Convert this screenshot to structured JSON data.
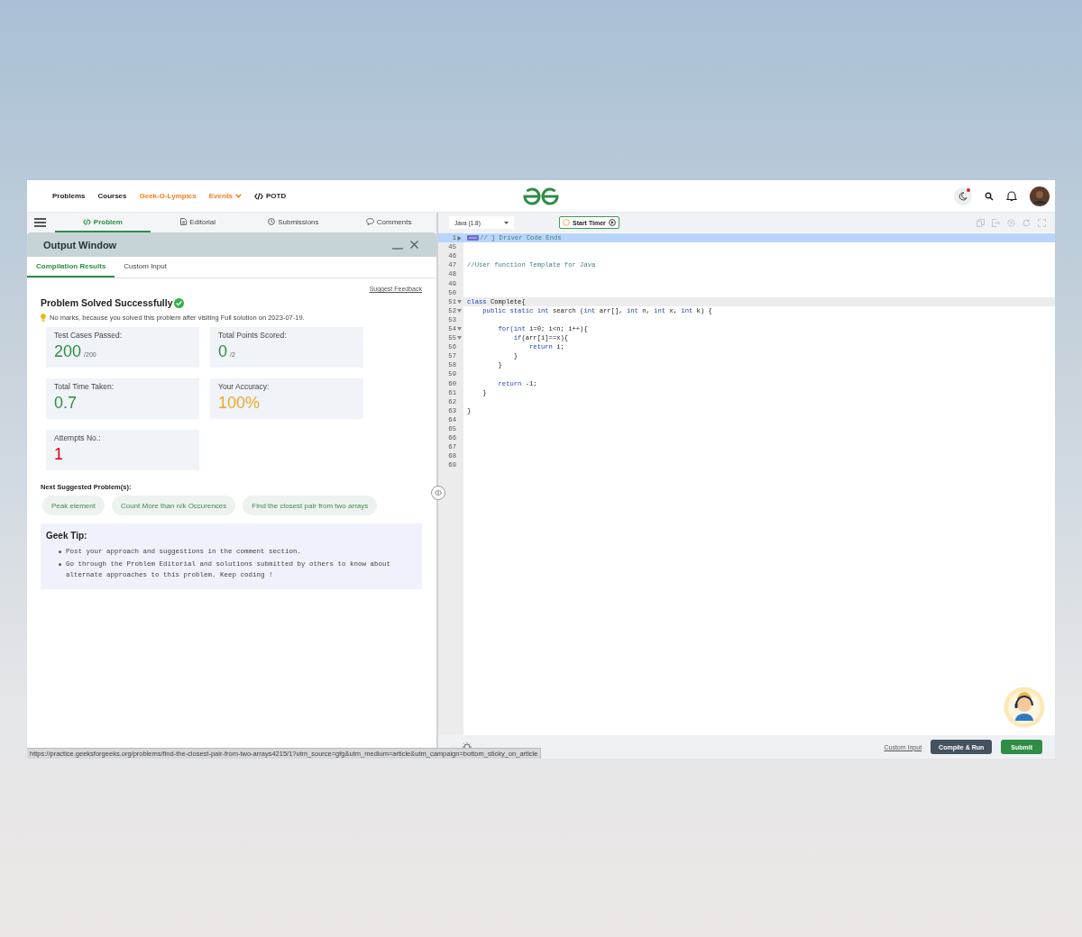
{
  "nav": {
    "items": [
      {
        "label": "Problems",
        "color": "#1e1e1e",
        "caret": false,
        "code_icon": false
      },
      {
        "label": "Courses",
        "color": "#1e1e1e",
        "caret": false,
        "code_icon": false
      },
      {
        "label": "Geek-O-Lympics",
        "color": "#f07f19",
        "caret": false,
        "code_icon": false
      },
      {
        "label": "Events",
        "color": "#f07f19",
        "caret": true,
        "code_icon": false
      },
      {
        "label": "POTD",
        "color": "#1e1e1e",
        "caret": false,
        "code_icon": true
      }
    ]
  },
  "panel_tabs": [
    {
      "label": "Problem",
      "selected": true
    },
    {
      "label": "Editorial",
      "selected": false
    },
    {
      "label": "Submissions",
      "selected": false
    },
    {
      "label": "Comments",
      "selected": false
    }
  ],
  "output_window": {
    "title": "Output Window",
    "tabs": [
      {
        "label": "Compilation Results",
        "selected": true
      },
      {
        "label": "Custom Input",
        "selected": false
      }
    ],
    "feedback_link": "Suggest Feedback",
    "status": "Problem Solved Successfully",
    "note": "No marks, because you solved this problem after visiting Full solution on 2023-07-19.",
    "stats": [
      {
        "label": "Test Cases Passed:",
        "value": "200",
        "total": "/200",
        "color": "#2f8d46"
      },
      {
        "label": "Total Points Scored:",
        "value": "0",
        "total": "/2",
        "color": "#2f8d46"
      },
      {
        "label": "Total Time Taken:",
        "value": "0.7",
        "color": "#2f8d46"
      },
      {
        "label": "Your Accuracy:",
        "value": "100%",
        "color": "#e9a92b"
      },
      {
        "label": "Attempts No.:",
        "value": "1",
        "color": "#d5000f"
      }
    ],
    "suggested_heading": "Next Suggested Problem(s):",
    "suggested": [
      "Peak element",
      "Count More than n/k Occurences",
      "Find the closest pair from two arrays"
    ],
    "tip": {
      "title": "Geek Tip:",
      "items": [
        "Post your approach and suggestions in the comment section.",
        "Go through the Problem Editorial and solutions submitted by others to know about alternate approaches to this problem. Keep coding !"
      ]
    }
  },
  "editor": {
    "language": "Java (1.8)",
    "timer_button": "Start Timer",
    "lines": [
      {
        "num": "1",
        "foldable": true,
        "collapsed": true,
        "selected": true,
        "current": false,
        "tokens": [
          {
            "text": "// } Driver Code Ends",
            "kind": "comment"
          }
        ]
      },
      {
        "num": "45",
        "foldable": false,
        "selected": false,
        "current": false
      },
      {
        "num": "46",
        "foldable": false,
        "selected": false,
        "current": false
      },
      {
        "num": "47",
        "foldable": false,
        "selected": false,
        "current": false,
        "tokens": [
          {
            "text": "//User function Template for Java",
            "kind": "comment"
          }
        ]
      },
      {
        "num": "48",
        "foldable": false,
        "selected": false,
        "current": false
      },
      {
        "num": "49",
        "foldable": false,
        "selected": false,
        "current": false
      },
      {
        "num": "50",
        "foldable": false,
        "selected": false,
        "current": false
      },
      {
        "num": "51",
        "foldable": true,
        "collapsed": false,
        "selected": false,
        "current": true,
        "tokens": [
          {
            "text": "class",
            "kind": "keyword"
          },
          {
            "text": " Complete{",
            "kind": "plain"
          }
        ]
      },
      {
        "num": "52",
        "foldable": true,
        "collapsed": false,
        "selected": false,
        "current": false,
        "tokens": [
          {
            "text": "    public static int",
            "kind": "keyword"
          },
          {
            "text": " search (",
            "kind": "plain"
          },
          {
            "text": "int",
            "kind": "keyword"
          },
          {
            "text": " arr[], ",
            "kind": "plain"
          },
          {
            "text": "int",
            "kind": "keyword"
          },
          {
            "text": " n, ",
            "kind": "plain"
          },
          {
            "text": "int",
            "kind": "keyword"
          },
          {
            "text": " x, ",
            "kind": "plain"
          },
          {
            "text": "int",
            "kind": "keyword"
          },
          {
            "text": " k) {",
            "kind": "plain"
          }
        ]
      },
      {
        "num": "53",
        "foldable": false,
        "selected": false,
        "current": false
      },
      {
        "num": "54",
        "foldable": true,
        "collapsed": false,
        "selected": false,
        "current": false,
        "tokens": [
          {
            "text": "        for(int",
            "kind": "keyword"
          },
          {
            "text": " i=0; i<n; i++){",
            "kind": "plain"
          }
        ]
      },
      {
        "num": "55",
        "foldable": true,
        "collapsed": false,
        "selected": false,
        "current": false,
        "tokens": [
          {
            "text": "            if",
            "kind": "keyword"
          },
          {
            "text": "(arr[i]==x){",
            "kind": "plain"
          }
        ]
      },
      {
        "num": "56",
        "foldable": false,
        "selected": false,
        "current": false,
        "tokens": [
          {
            "text": "                return",
            "kind": "keyword"
          },
          {
            "text": " i;",
            "kind": "plain"
          }
        ]
      },
      {
        "num": "57",
        "foldable": false,
        "selected": false,
        "current": false,
        "tokens": [
          {
            "text": "            }",
            "kind": "plain"
          }
        ]
      },
      {
        "num": "58",
        "foldable": false,
        "selected": false,
        "current": false,
        "tokens": [
          {
            "text": "        }",
            "kind": "plain"
          }
        ]
      },
      {
        "num": "59",
        "foldable": false,
        "selected": false,
        "current": false
      },
      {
        "num": "60",
        "foldable": false,
        "selected": false,
        "current": false,
        "tokens": [
          {
            "text": "        return",
            "kind": "keyword"
          },
          {
            "text": " -1;",
            "kind": "plain"
          }
        ]
      },
      {
        "num": "61",
        "foldable": false,
        "selected": false,
        "current": false,
        "tokens": [
          {
            "text": "    }",
            "kind": "plain"
          }
        ]
      },
      {
        "num": "62",
        "foldable": false,
        "selected": false,
        "current": false
      },
      {
        "num": "63",
        "foldable": false,
        "selected": false,
        "current": false,
        "tokens": [
          {
            "text": "}",
            "kind": "plain"
          }
        ]
      },
      {
        "num": "64",
        "foldable": false,
        "selected": false,
        "current": false
      },
      {
        "num": "65",
        "foldable": false,
        "selected": false,
        "current": false
      },
      {
        "num": "66",
        "foldable": false,
        "selected": false,
        "current": false
      },
      {
        "num": "67",
        "foldable": false,
        "selected": false,
        "current": false
      },
      {
        "num": "68",
        "foldable": false,
        "selected": false,
        "current": false
      },
      {
        "num": "69",
        "foldable": false,
        "selected": false,
        "current": false
      }
    ],
    "custom_input_link": "Custom Input",
    "compile_button": "Compile & Run",
    "submit_button": "Submit"
  },
  "status_url": "https://practice.geeksforgeeks.org/problems/find-the-closest-pair-from-two-arrays4215/1?utm_source=gfg&utm_medium=article&utm_campaign=bottom_sticky_on_article"
}
